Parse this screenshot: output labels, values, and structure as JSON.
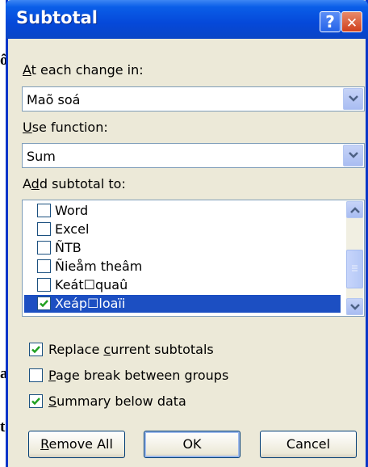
{
  "background": {
    "fragments": [
      "ối",
      "a",
      "t"
    ]
  },
  "dialog": {
    "title": "Subtotal",
    "help_glyph": "?",
    "close_glyph": "✕"
  },
  "at_each_change": {
    "label_hotkey": "A",
    "label_rest": "t each change in:",
    "value": "Maõ soá"
  },
  "use_function": {
    "label_hotkey": "U",
    "label_rest": "se function:",
    "value": "Sum"
  },
  "add_subtotal": {
    "label_pre": "A",
    "label_hotkey": "d",
    "label_rest": "d subtotal to:",
    "items": [
      {
        "label": "Word",
        "checked": false,
        "selected": false
      },
      {
        "label": "Excel",
        "checked": false,
        "selected": false
      },
      {
        "label": "ÑTB",
        "checked": false,
        "selected": false
      },
      {
        "label": "Ñieåm theâm",
        "checked": false,
        "selected": false
      },
      {
        "label": "Keát☐quaû",
        "checked": false,
        "selected": false
      },
      {
        "label": "Xeáp☐loaïi",
        "checked": true,
        "selected": true
      }
    ]
  },
  "options": {
    "replace_pre": "Replace ",
    "replace_hotkey": "c",
    "replace_rest": "urrent subtotals",
    "replace_checked": true,
    "pagebreak_hotkey": "P",
    "pagebreak_rest": "age break between groups",
    "pagebreak_checked": false,
    "summary_hotkey": "S",
    "summary_rest": "ummary below data",
    "summary_checked": true
  },
  "buttons": {
    "remove_hotkey": "R",
    "remove_rest": "emove All",
    "ok": "OK",
    "cancel": "Cancel"
  },
  "colors": {
    "title_bar": "#0548d9",
    "selection": "#1c4fc2",
    "dialog_bg": "#ece9d8",
    "check": "#21a121"
  }
}
